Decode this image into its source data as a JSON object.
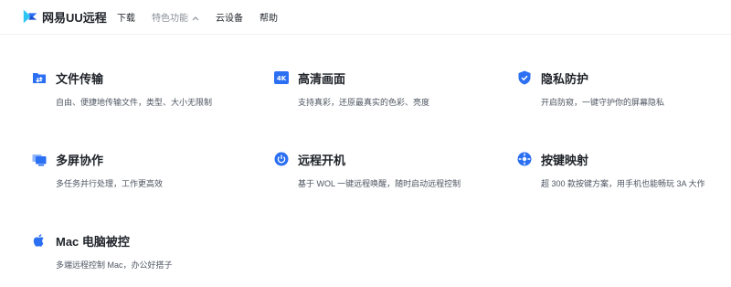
{
  "brand": {
    "name": "网易UU远程",
    "color": "#2b6ff3"
  },
  "nav": {
    "items": [
      {
        "label": "下载"
      },
      {
        "label": "特色功能",
        "active": true
      },
      {
        "label": "云设备"
      },
      {
        "label": "帮助"
      }
    ]
  },
  "features": [
    {
      "title": "文件传输",
      "desc": "自由、便捷地传输文件，类型、大小无限制",
      "icon": "folder-transfer-icon"
    },
    {
      "title": "高清画面",
      "desc": "支持真彩，还原最真实的色彩、亮度",
      "icon": "4k-icon",
      "icon_text": "4K"
    },
    {
      "title": "隐私防护",
      "desc": "开启防窥，一键守护你的屏幕隐私",
      "icon": "shield-check-icon"
    },
    {
      "title": "多屏协作",
      "desc": "多任务并行处理，工作更高效",
      "icon": "multi-screen-icon"
    },
    {
      "title": "远程开机",
      "desc": "基于 WOL 一键远程唤醒，随时启动远程控制",
      "icon": "power-icon"
    },
    {
      "title": "按键映射",
      "desc": "超 300 款按键方案，用手机也能畅玩 3A 大作",
      "icon": "key-mapping-icon"
    },
    {
      "title": "Mac 电脑被控",
      "desc": "多端远程控制 Mac，办公好搭子",
      "icon": "apple-icon"
    }
  ],
  "colors": {
    "accent": "#2b6ff3",
    "text": "#1f2329",
    "muted": "#8a8f99"
  }
}
